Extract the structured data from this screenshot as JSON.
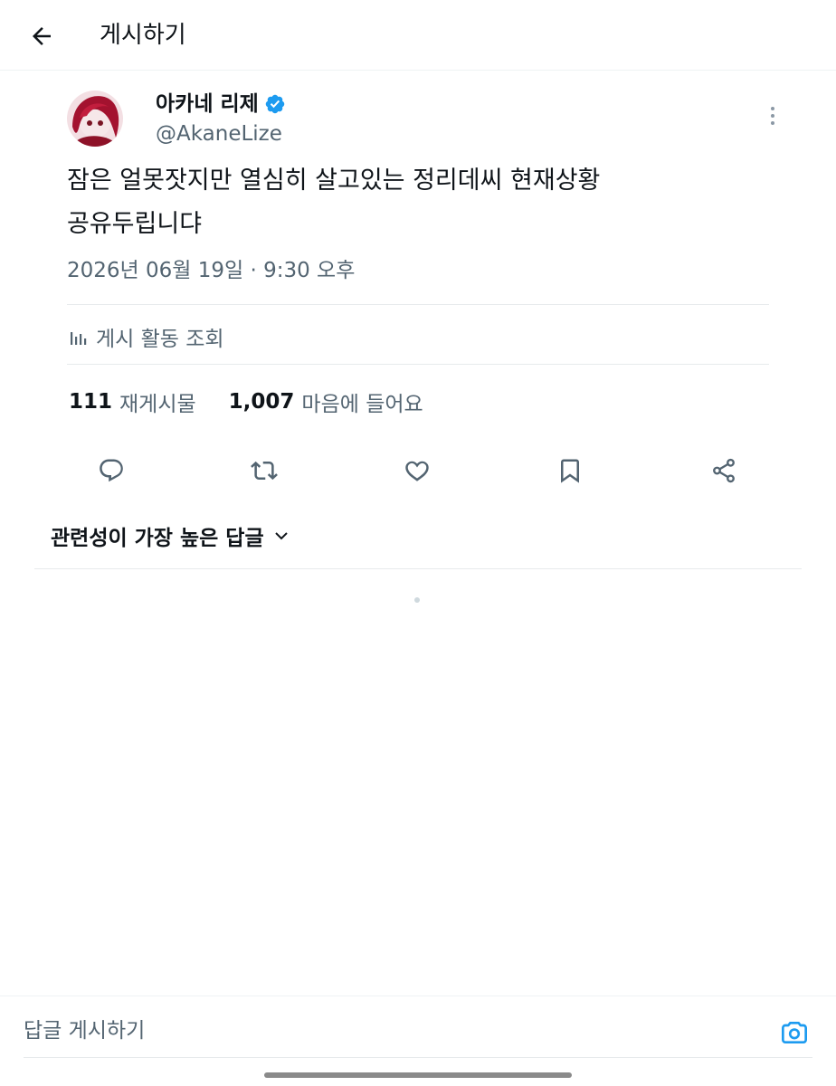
{
  "header": {
    "title": "게시하기",
    "back_icon": "arrow-left-icon"
  },
  "post": {
    "author": {
      "name": "아카네 리제",
      "handle": "@AkaneLize",
      "verified": true,
      "verified_color": "#1d9bf0"
    },
    "text_lines": [
      "잠은 얼못잣지만 열심히 살고있는 정리데씨 현재상황",
      "공유두립니댜"
    ],
    "meta": "2026년 06월 19일 · 9:30 오후",
    "activity_label": "게시 활동 조회",
    "stats": {
      "reposts_count": "111",
      "reposts_label": "재게시물",
      "likes_count": "1,007",
      "likes_label": "마음에 들어요"
    },
    "actions": [
      "reply-icon",
      "repost-icon",
      "like-icon",
      "bookmark-icon",
      "share-icon"
    ]
  },
  "replies": {
    "sort_label": "관련성이 가장 높은 답글"
  },
  "composer": {
    "placeholder": "답글 게시하기",
    "camera_icon": "camera-icon",
    "accent": "#1d9bf0"
  }
}
